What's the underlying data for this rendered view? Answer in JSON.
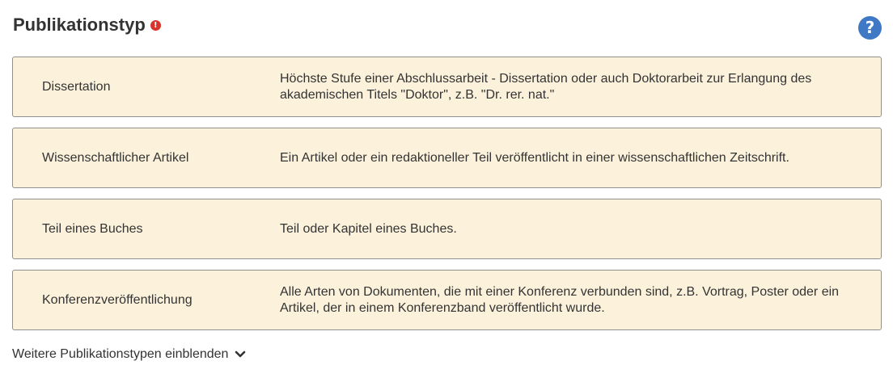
{
  "header": {
    "title": "Publikationstyp",
    "required_icon": "exclamation-circle-icon",
    "help_icon": "question-circle-icon",
    "help_glyph": "?",
    "required_glyph": "!"
  },
  "colors": {
    "card_background": "#fcf2dc",
    "card_border": "#8f8f8f",
    "required": "#d9342b",
    "help": "#3f78c4"
  },
  "types": [
    {
      "name": "Dissertation",
      "description": "Höchste Stufe einer Abschlussarbeit - Dissertation oder auch Doktorarbeit zur Erlangung des akademischen Titels \"Doktor\", z.B. \"Dr. rer. nat.\""
    },
    {
      "name": "Wissenschaftlicher Artikel",
      "description": "Ein Artikel oder ein redaktioneller Teil veröffentlicht in einer wissenschaftlichen Zeitschrift."
    },
    {
      "name": "Teil eines Buches",
      "description": "Teil oder Kapitel eines Buches."
    },
    {
      "name": "Konferenzveröffentlichung",
      "description": "Alle Arten von Dokumenten, die mit einer Konferenz verbunden sind, z.B. Vortrag, Poster oder ein Artikel, der in einem Konferenzband veröffentlicht wurde."
    }
  ],
  "more_link": {
    "label": "Weitere Publikationstypen einblenden",
    "icon": "chevron-down-icon"
  }
}
